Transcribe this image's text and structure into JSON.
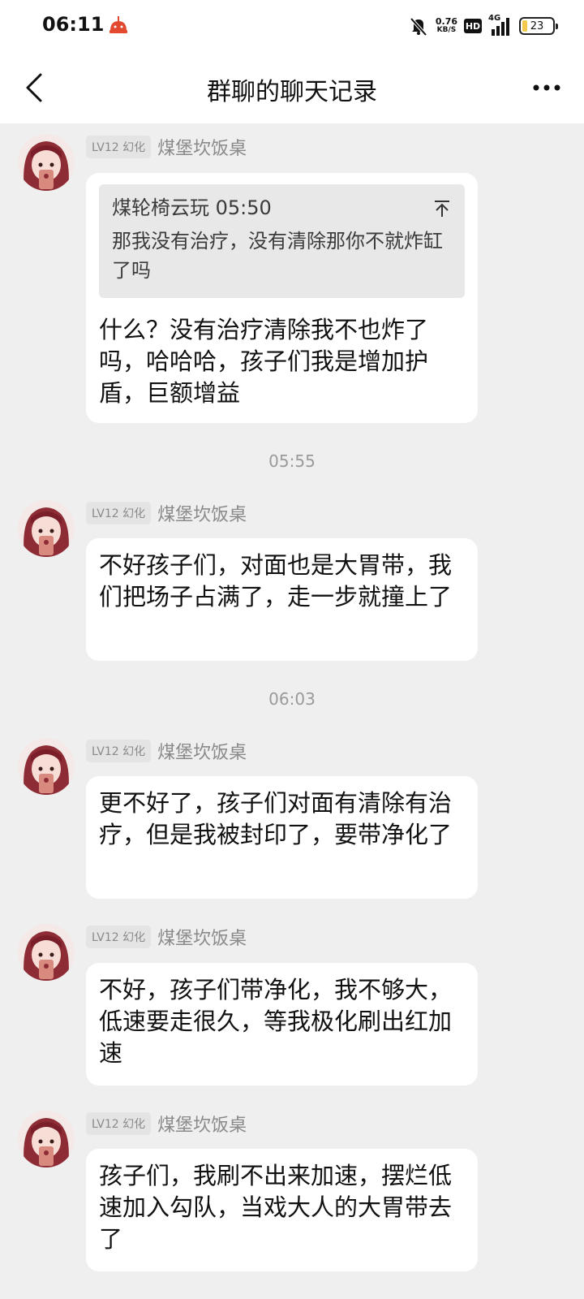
{
  "status_bar": {
    "time": "06:11",
    "speed_value": "0.76",
    "speed_unit": "KB/S",
    "hd": "HD",
    "network": "4G",
    "battery": "23"
  },
  "header": {
    "title": "群聊的聊天记录"
  },
  "messages": [
    {
      "level": "LV12 幻化",
      "sender": "煤堡坎饭桌",
      "quote": {
        "header": "煤轮椅云玩 05:50",
        "text": "那我没有治疗，没有清除那你不就炸缸了吗"
      },
      "text": "什么？没有治疗清除我不也炸了吗，哈哈哈，孩子们我是增加护盾，巨额增益"
    },
    {
      "level": "LV12 幻化",
      "sender": "煤堡坎饭桌",
      "text": "不好孩子们，对面也是大胃带，我们把场子占满了，走一步就撞上了"
    },
    {
      "level": "LV12 幻化",
      "sender": "煤堡坎饭桌",
      "text": "更不好了，孩子们对面有清除有治疗，但是我被封印了，要带净化了"
    },
    {
      "level": "LV12 幻化",
      "sender": "煤堡坎饭桌",
      "text": "不好，孩子们带净化，我不够大，低速要走很久，等我极化刷出红加速"
    },
    {
      "level": "LV12 幻化",
      "sender": "煤堡坎饭桌",
      "text": "孩子们，我刷不出来加速，摆烂低速加入勾队，当戏大人的大胃带去了"
    }
  ],
  "timestamps": [
    "05:55",
    "06:03"
  ]
}
